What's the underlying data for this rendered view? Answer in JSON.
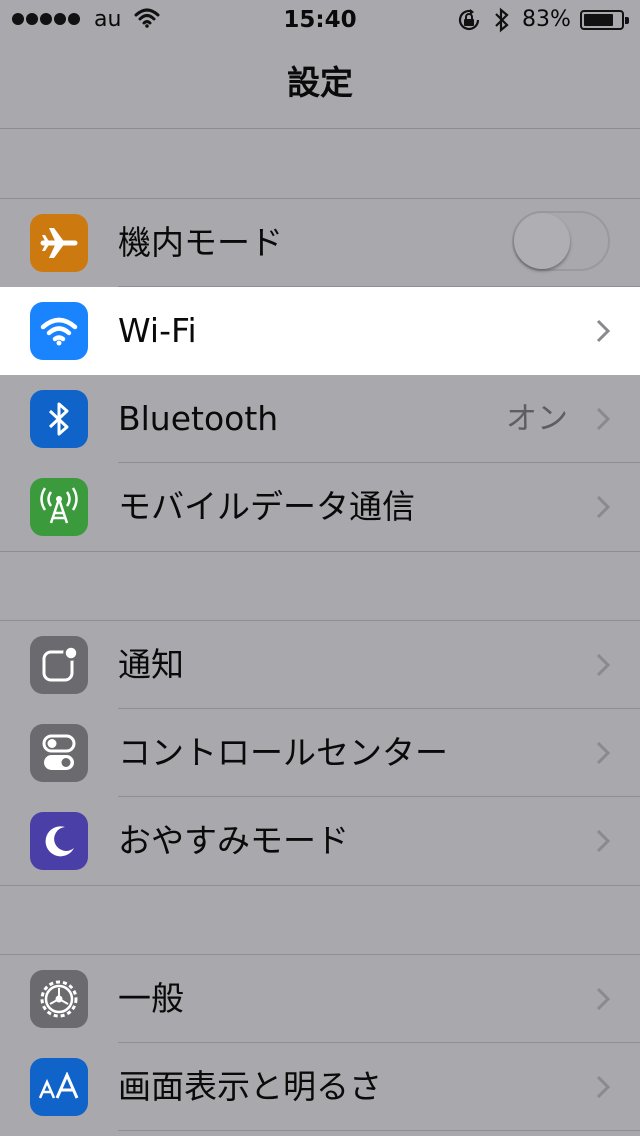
{
  "status_bar": {
    "carrier": "au",
    "time": "15:40",
    "battery_percent": "83%",
    "battery_level": 0.83
  },
  "nav": {
    "title": "設定"
  },
  "groups": [
    {
      "rows": [
        {
          "label": "機内モード",
          "icon": "airplane-icon",
          "icon_color": "#cc7a10",
          "control": "toggle",
          "toggle_on": false
        },
        {
          "label": "Wi-Fi",
          "icon": "wifi-icon",
          "icon_color": "#1a84ff",
          "control": "chevron",
          "highlighted": true
        },
        {
          "label": "Bluetooth",
          "value": "オン",
          "icon": "bluetooth-icon",
          "icon_color": "#0f63c9",
          "control": "chevron"
        },
        {
          "label": "モバイルデータ通信",
          "icon": "cellular-antenna-icon",
          "icon_color": "#3a9a3c",
          "control": "chevron"
        }
      ]
    },
    {
      "rows": [
        {
          "label": "通知",
          "icon": "notifications-icon",
          "icon_color": "#6b6a6f",
          "control": "chevron"
        },
        {
          "label": "コントロールセンター",
          "icon": "control-center-icon",
          "icon_color": "#6b6a6f",
          "control": "chevron"
        },
        {
          "label": "おやすみモード",
          "icon": "moon-icon",
          "icon_color": "#4a3fa6",
          "control": "chevron"
        }
      ]
    },
    {
      "rows": [
        {
          "label": "一般",
          "icon": "gear-icon",
          "icon_color": "#6b6a6f",
          "control": "chevron"
        },
        {
          "label": "画面表示と明るさ",
          "icon": "display-text-size-icon",
          "icon_color": "#0f63c9",
          "control": "chevron"
        }
      ]
    }
  ],
  "colors": {
    "background": "#a9a8ac",
    "highlight": "#ffffff",
    "chevron": "#8a898e"
  }
}
